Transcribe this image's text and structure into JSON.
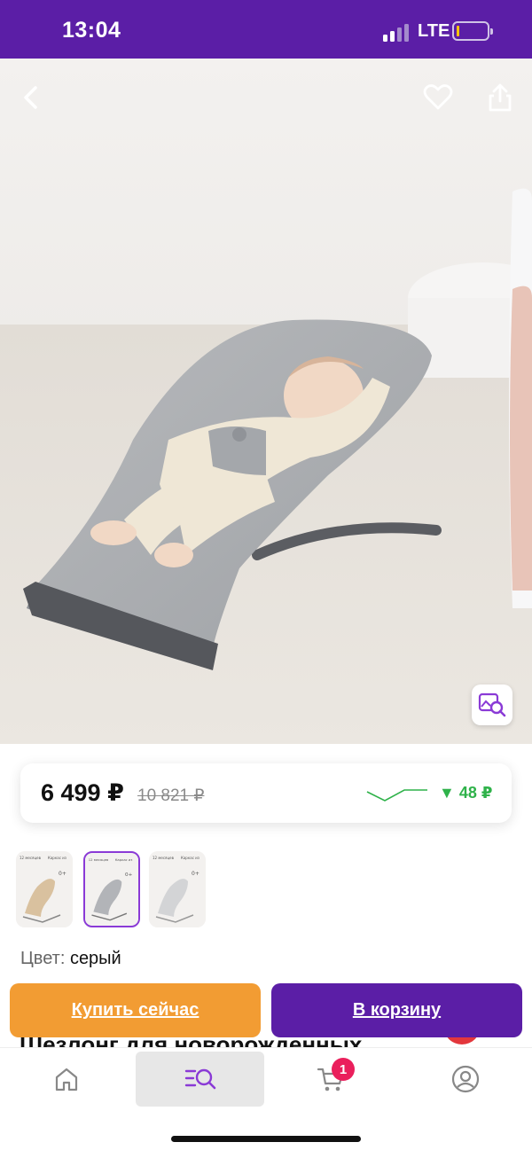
{
  "status_bar": {
    "time": "13:04",
    "network": "LTE",
    "bg_color": "#5b1ea6",
    "battery_color": "#ffc400"
  },
  "product": {
    "price": "6 499 ₽",
    "old_price": "10 821 ₽",
    "price_change": "▼ 48 ₽",
    "price_change_color": "#2fb24a",
    "color_label": "Цвет:",
    "color_value": "серый",
    "title": "Шезлонг для новорожденных",
    "variants": [
      {
        "name": "beige",
        "tag_left": "12 месяцев гарантии",
        "tag_right": "Каркас из металла",
        "age": "0+"
      },
      {
        "name": "gray",
        "tag_left": "12 месяцев гарантии",
        "tag_right": "Каркас из металла",
        "age": "0+",
        "selected": true
      },
      {
        "name": "light-gray",
        "tag_left": "12 месяцев гарантии",
        "tag_right": "Каркас из металла",
        "age": "0+"
      }
    ]
  },
  "actions": {
    "buy_now": "Купить сейчас",
    "add_to_cart": "В корзину",
    "buy_color": "#f29c33",
    "cart_color": "#5b1ea6"
  },
  "nav": {
    "cart_count": "1",
    "badge_color": "#ea1f5c",
    "items": [
      "home-icon",
      "catalog-search-icon",
      "cart-icon",
      "profile-icon"
    ],
    "active_index": 1
  },
  "icons": {
    "top_left": "back-chevron-icon",
    "top_right": [
      "heart-icon",
      "share-icon"
    ],
    "hero_corner": "image-search-icon"
  }
}
